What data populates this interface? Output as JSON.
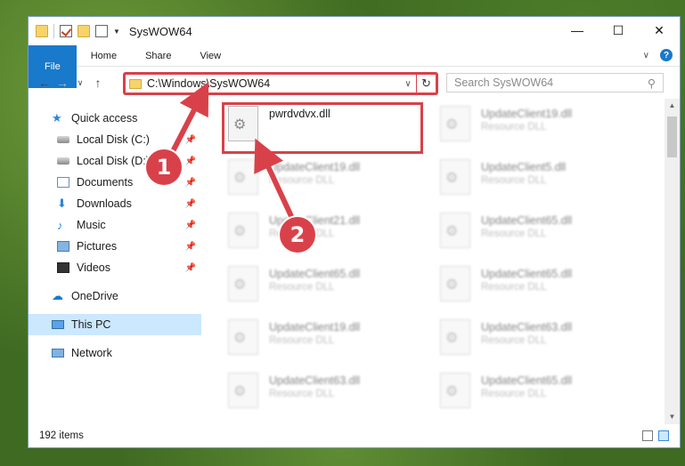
{
  "window": {
    "title": "SysWOW64",
    "controls": {
      "minimize": "—",
      "maximize": "☐",
      "close": "✕"
    }
  },
  "ribbon": {
    "tabs": [
      "File",
      "Home",
      "Share",
      "View"
    ],
    "expand": "∨",
    "help": "?"
  },
  "address": {
    "path": "C:\\Windows\\SysWOW64",
    "chevron": "∨",
    "refresh": "↻",
    "search_placeholder": "Search SysWOW64"
  },
  "nav": {
    "quick_access": "Quick access",
    "items": [
      {
        "label": "Local Disk (C:)"
      },
      {
        "label": "Local Disk (D:)"
      },
      {
        "label": "Documents"
      },
      {
        "label": "Downloads"
      },
      {
        "label": "Music"
      },
      {
        "label": "Pictures"
      },
      {
        "label": "Videos"
      }
    ],
    "onedrive": "OneDrive",
    "this_pc": "This PC",
    "network": "Network"
  },
  "files": [
    {
      "name": "pwrdvdvx.dll",
      "type": ""
    },
    {
      "name": "UpdateClient19.dll",
      "type": "Resource DLL"
    },
    {
      "name": "UpdateClient19.dll",
      "type": "Resource DLL"
    },
    {
      "name": "UpdateClient5.dll",
      "type": "Resource DLL"
    },
    {
      "name": "UpdateClient21.dll",
      "type": "Resource DLL"
    },
    {
      "name": "UpdateClient65.dll",
      "type": "Resource DLL"
    },
    {
      "name": "UpdateClient65.dll",
      "type": "Resource DLL"
    },
    {
      "name": "UpdateClient65.dll",
      "type": "Resource DLL"
    },
    {
      "name": "UpdateClient19.dll",
      "type": "Resource DLL"
    },
    {
      "name": "UpdateClient63.dll",
      "type": "Resource DLL"
    },
    {
      "name": "UpdateClient63.dll",
      "type": "Resource DLL"
    },
    {
      "name": "UpdateClient65.dll",
      "type": "Resource DLL"
    }
  ],
  "status": {
    "count": "192 items"
  },
  "annotations": {
    "step1": "1",
    "step2": "2"
  },
  "colors": {
    "accent": "#1979ca",
    "highlight": "#d9414a"
  }
}
